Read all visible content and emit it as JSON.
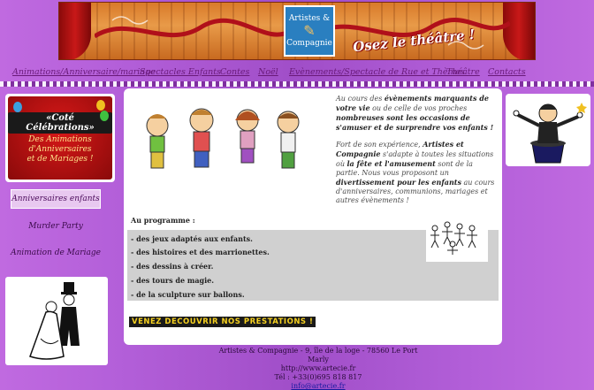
{
  "header": {
    "logo_line1": "Artistes &",
    "logo_line2": "Compagnie",
    "tagline": "Osez le théâtre !"
  },
  "nav": [
    {
      "label": "Animations/Anniversaire/mariage"
    },
    {
      "label": "Spectacles Enfants"
    },
    {
      "label": "Contes"
    },
    {
      "label": "Noël"
    },
    {
      "label": "Evènements/Spectacle de Rue et Thèmes"
    },
    {
      "label": "Théâtre"
    },
    {
      "label": "Contacts"
    }
  ],
  "promo": {
    "title": "«Coté Célébrations»",
    "line1": "Des Animations",
    "line2": "d'Anniversaires",
    "line3": "et de Mariages !"
  },
  "sidebar": [
    {
      "label": "Anniversaires enfants",
      "active": true
    },
    {
      "label": "Murder Party",
      "active": false
    },
    {
      "label": "Animation de Mariage",
      "active": false
    }
  ],
  "intro": {
    "p1_a": "Au cours des ",
    "p1_b": "évènements marquants de votre vie",
    "p1_c": " ou de celle de vos proches ",
    "p1_d": "nombreuses sont les occasions de s'amuser et de surprendre vos enfants !",
    "p2_a": "Fort de son expérience, ",
    "p2_b": "Artistes et Compagnie",
    "p2_c": " s'adapte à toutes les situations où ",
    "p2_d": "la fête et l'amusement",
    "p2_e": " sont de la partie. Nous vous proposont un ",
    "p2_f": "divertissement pour les enfants",
    "p2_g": " au cours d'anniversaires, communions, mariages et autres évènements !"
  },
  "program": {
    "title": "Au programme :",
    "items": [
      "- des jeux adaptés aux enfants.",
      "- des histoires et des marrionettes.",
      "- des dessins à créer.",
      "- des tours de magie.",
      "- de la sculpture sur ballons."
    ]
  },
  "cta": "VENEZ DECOUVRIR NOS PRESTATIONS !",
  "footer": {
    "address": "Artistes & Compagnie - 9, île de la loge - 78560 Le Port Marly",
    "url": "http://www.artecie.fr",
    "phone": "Tél : +33(0)695 818 817",
    "email": "info@artecie.fr"
  },
  "colors": {
    "background": "#b35fd9",
    "nav_text": "#6a1a7a",
    "cta_text": "#f5d020",
    "curtain": "#c81818"
  }
}
